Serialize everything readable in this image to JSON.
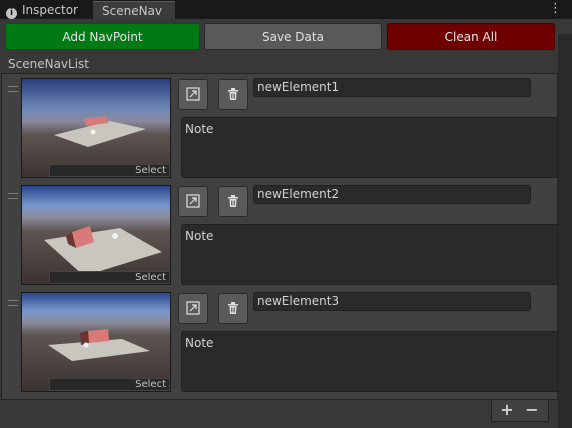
{
  "tabs": [
    {
      "label": "Inspector",
      "icon": "info-icon"
    },
    {
      "label": "SceneNav"
    }
  ],
  "toolbar": {
    "add_label": "Add NavPoint",
    "save_label": "Save Data",
    "clean_label": "Clean All"
  },
  "colors": {
    "add": "#007a14",
    "save": "#595959",
    "clean": "#6e0000"
  },
  "list": {
    "title": "SceneNavList",
    "items": [
      {
        "name": "newElement1",
        "note": "Note",
        "select_label": "Select",
        "icons": [
          "open-scene-icon",
          "trash-icon"
        ]
      },
      {
        "name": "newElement2",
        "note": "Note",
        "select_label": "Select",
        "icons": [
          "open-scene-icon",
          "trash-icon"
        ]
      },
      {
        "name": "newElement3",
        "note": "Note",
        "select_label": "Select",
        "icons": [
          "open-scene-icon",
          "trash-icon"
        ]
      }
    ],
    "add_label": "+",
    "remove_label": "−"
  }
}
